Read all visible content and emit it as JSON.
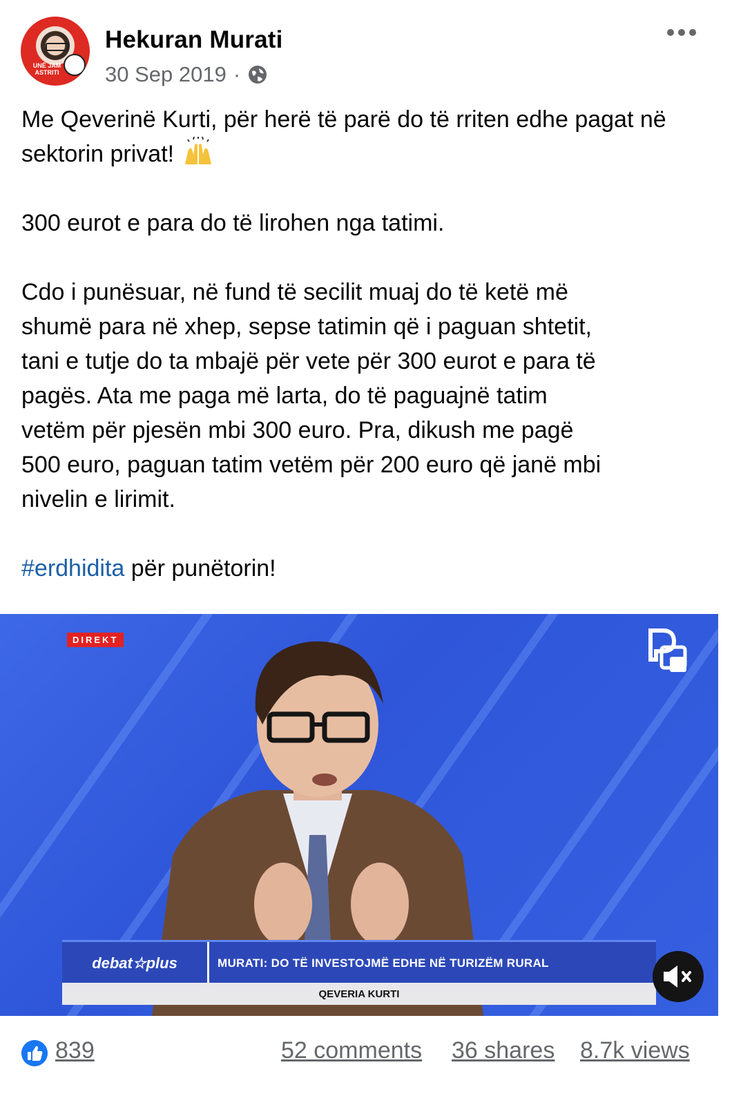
{
  "post": {
    "author": "Hekuran Murati",
    "date": "30 Sep 2019",
    "separator": "·",
    "avatar_badge": "UNË JAM ASTRITI",
    "paragraphs": {
      "p1": "Me Qeverinë Kurti, për herë të parë do të rriten edhe pagat në sektorin privat!",
      "p2": "300 eurot e para do të lirohen nga tatimi.",
      "p3_lines": [
        "Cdo i punësuar, në fund të secilit muaj do të ketë më",
        "shumë para në xhep, sepse tatimin që i paguan shtetit,",
        "tani e tutje do ta mbajë për vete për 300 eurot e para të",
        "pagës. Ata me paga më larta, do të paguajnë tatim",
        "vetëm për pjesën mbi 300 euro. Pra, dikush me pagë",
        "500 euro, paguan tatim vetëm për 200 euro që janë mbi",
        "nivelin e lirimit."
      ],
      "hashtag": "#erdhidita",
      "hashtag_rest": " për punëtorin!"
    },
    "emoji": "raising-hands-emoji"
  },
  "video": {
    "live_tag": "DIREKT",
    "logo": "debat☆plus",
    "headline": "MURATI: DO TË INVESTOJMË EDHE NË TURIZËM RURAL",
    "subline": "QEVERIA KURTI"
  },
  "stats": {
    "likes": "839",
    "comments": "52 comments",
    "shares": "36 shares",
    "views": "8.7k views"
  },
  "colors": {
    "hashtag": "#1b5fa8",
    "like_blue": "#1877f2",
    "secondary_text": "#65676b",
    "video_bg": "#3560e0"
  }
}
